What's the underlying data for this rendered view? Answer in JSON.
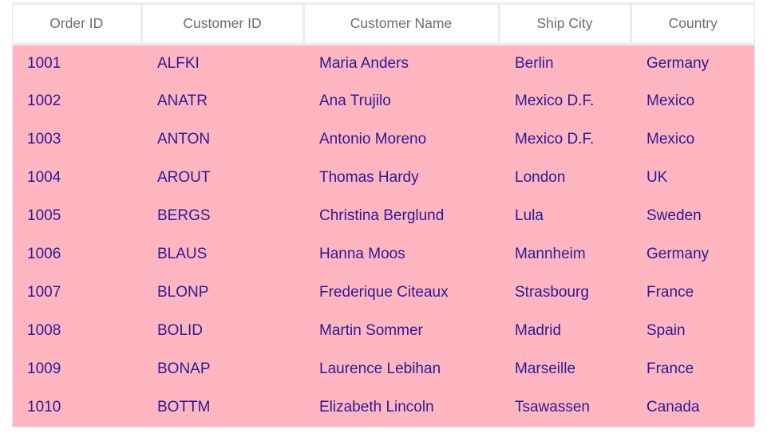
{
  "grid": {
    "columns": [
      {
        "field": "order_id",
        "header": "Order ID"
      },
      {
        "field": "customer_id",
        "header": "Customer ID"
      },
      {
        "field": "customer_name",
        "header": "Customer Name"
      },
      {
        "field": "ship_city",
        "header": "Ship City"
      },
      {
        "field": "country",
        "header": "Country"
      }
    ],
    "rows": [
      {
        "order_id": "1001",
        "customer_id": "ALFKI",
        "customer_name": "Maria Anders",
        "ship_city": "Berlin",
        "country": "Germany"
      },
      {
        "order_id": "1002",
        "customer_id": "ANATR",
        "customer_name": "Ana Trujilo",
        "ship_city": "Mexico D.F.",
        "country": "Mexico"
      },
      {
        "order_id": "1003",
        "customer_id": "ANTON",
        "customer_name": "Antonio Moreno",
        "ship_city": "Mexico D.F.",
        "country": "Mexico"
      },
      {
        "order_id": "1004",
        "customer_id": "AROUT",
        "customer_name": "Thomas Hardy",
        "ship_city": "London",
        "country": "UK"
      },
      {
        "order_id": "1005",
        "customer_id": "BERGS",
        "customer_name": "Christina Berglund",
        "ship_city": "Lula",
        "country": "Sweden"
      },
      {
        "order_id": "1006",
        "customer_id": "BLAUS",
        "customer_name": "Hanna Moos",
        "ship_city": "Mannheim",
        "country": "Germany"
      },
      {
        "order_id": "1007",
        "customer_id": "BLONP",
        "customer_name": "Frederique Citeaux",
        "ship_city": "Strasbourg",
        "country": "France"
      },
      {
        "order_id": "1008",
        "customer_id": "BOLID",
        "customer_name": "Martin Sommer",
        "ship_city": "Madrid",
        "country": "Spain"
      },
      {
        "order_id": "1009",
        "customer_id": "BONAP",
        "customer_name": "Laurence Lebihan",
        "ship_city": "Marseille",
        "country": "France"
      },
      {
        "order_id": "1010",
        "customer_id": "BOTTM",
        "customer_name": "Elizabeth Lincoln",
        "ship_city": "Tsawassen",
        "country": "Canada"
      }
    ],
    "colors": {
      "row_background": "#ffb6c1",
      "row_text": "#2a1a96",
      "header_background": "#ffffff",
      "header_text": "#6d6d6d",
      "grid_line": "#ececec"
    }
  }
}
